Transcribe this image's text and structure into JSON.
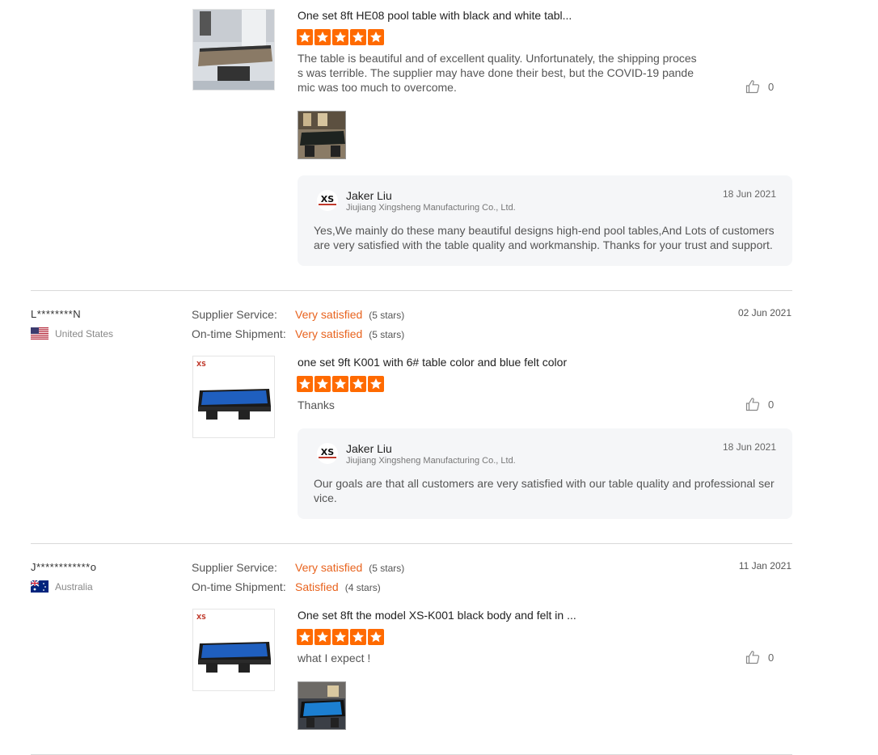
{
  "reviews": [
    {
      "product_title": "One set 8ft HE08 pool table with black and white tabl...",
      "stars": 5,
      "text": "The table is beautiful  and of excellent quality. Unfortunately,  the shipping process was terrible.   The supplier may have done their best, but the COVID-19 pandemic was too much to overcome.",
      "likes": "0",
      "reply": {
        "name": "Jaker Liu",
        "company": "Jiujiang Xingsheng Manufacturing Co., Ltd.",
        "date": "18 Jun 2021",
        "text": "Yes,We mainly do these many beautiful designs high-end pool tables,And Lots of customers are very satisfied with the table quality and workmanship. Thanks for your trust and support."
      }
    },
    {
      "buyer": "L********N",
      "country": "United States",
      "date": "02 Jun 2021",
      "supplier_service_label": "Supplier Service:",
      "supplier_service_value": "Very satisfied",
      "supplier_service_stars": "(5 stars)",
      "shipment_label": "On-time Shipment:",
      "shipment_value": "Very satisfied",
      "shipment_stars": "(5 stars)",
      "product_title": "one set 9ft K001 with 6# table color and blue felt color",
      "stars": 5,
      "text": "Thanks",
      "likes": "0",
      "reply": {
        "name": "Jaker Liu",
        "company": "Jiujiang Xingsheng Manufacturing Co., Ltd.",
        "date": "18 Jun 2021",
        "text": "Our goals are that all customers are very satisfied with our table quality and professional service."
      }
    },
    {
      "buyer": "J************o",
      "country": "Australia",
      "date": "11 Jan 2021",
      "supplier_service_label": "Supplier Service:",
      "supplier_service_value": "Very satisfied",
      "supplier_service_stars": "(5 stars)",
      "shipment_label": "On-time Shipment:",
      "shipment_value": "Satisfied",
      "shipment_stars": "(4 stars)",
      "product_title": "One set 8ft the model XS-K001 black body and felt in ...",
      "stars": 5,
      "text": "what I expect !",
      "likes": "0"
    }
  ],
  "colors": {
    "accent": "#e8631e",
    "star": "#ff6a00",
    "reply_bg": "#f5f6f8"
  },
  "icons": {
    "like": "thumbs-up-icon",
    "star": "star-icon"
  }
}
